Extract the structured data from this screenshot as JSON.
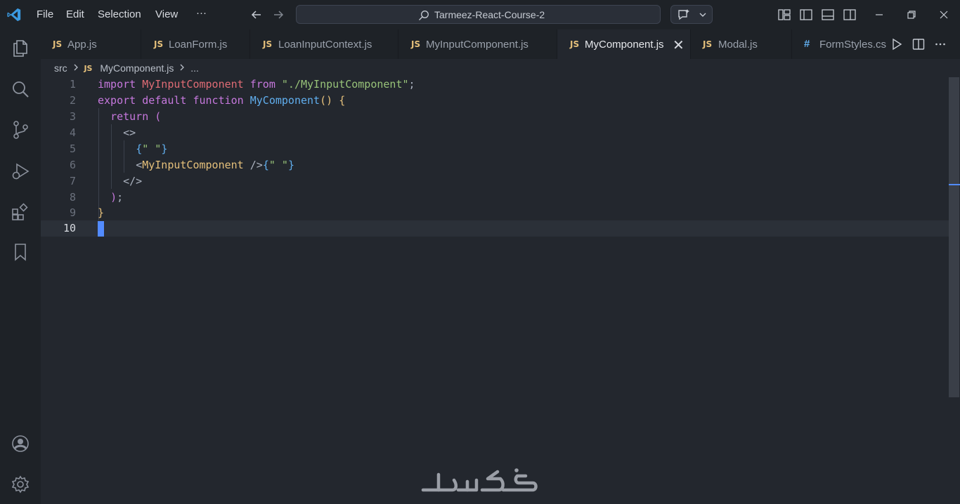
{
  "menu": [
    "File",
    "Edit",
    "Selection",
    "View",
    "···"
  ],
  "search": {
    "text": "Tarmeez-React-Course-2"
  },
  "tabs": [
    {
      "type": "JS",
      "name": "App.js"
    },
    {
      "type": "JS",
      "name": "LoanForm.js"
    },
    {
      "type": "JS",
      "name": "LoanInputContext.js"
    },
    {
      "type": "JS",
      "name": "MyInputComponent.js"
    },
    {
      "type": "JS",
      "name": "MyComponent.js",
      "active": true,
      "close": "✕"
    },
    {
      "type": "JS",
      "name": "Modal.js"
    },
    {
      "type": "#",
      "name": "FormStyles.cs"
    }
  ],
  "breadcrumb": {
    "folder": "src",
    "file_type": "JS",
    "file": "MyComponent.js",
    "more": "..."
  },
  "editor": {
    "line_numbers": [
      "1",
      "2",
      "3",
      "4",
      "5",
      "6",
      "7",
      "8",
      "9",
      "10"
    ],
    "current_line": 10,
    "lines": [
      "import MyInputComponent from \"./MyInputComponent\";",
      "export default function MyComponent() {",
      "  return (",
      "    <>",
      "      {\" \"}",
      "      <MyInputComponent />{\" \"}",
      "    </>",
      "  );",
      "}",
      ""
    ]
  },
  "theme": {
    "background": "#23272e",
    "titlebar": "#1e2227",
    "cursor": "#528bff",
    "keyword": "#c678dd",
    "function": "#61afef",
    "string": "#98c379"
  },
  "watermark": {
    "logo": "خمسات"
  }
}
